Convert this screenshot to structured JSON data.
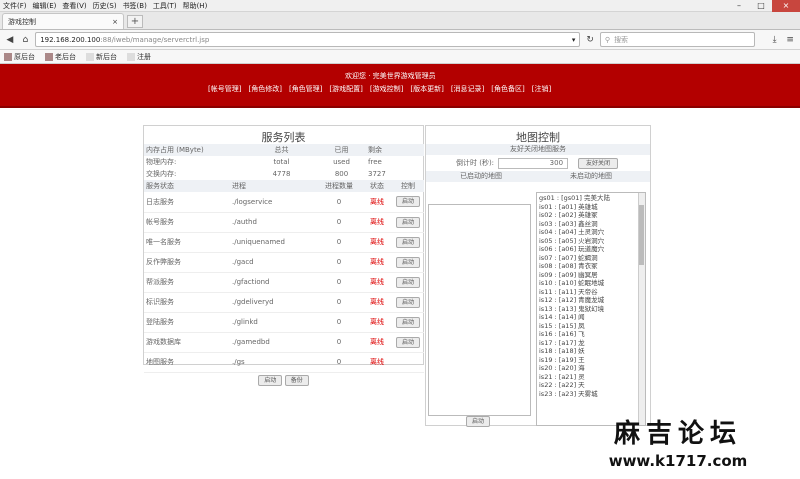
{
  "browser": {
    "menu": [
      "文件(F)",
      "编辑(E)",
      "查看(V)",
      "历史(S)",
      "书签(B)",
      "工具(T)",
      "帮助(H)"
    ],
    "tab_title": "游戏控制",
    "tab_close": "×",
    "new_tab": "+",
    "url_host": "192.168.200.100",
    "url_rest": ":88/iweb/manage/serverctrl.jsp",
    "search_placeholder": "搜索",
    "bookmarks": [
      "原后台",
      "老后台",
      "新后台",
      "注册"
    ]
  },
  "banner": {
    "title": "欢迎您 · 完美世界游戏管理员",
    "menu": [
      "[帐号管理]",
      "[角色修改]",
      "[角色管理]",
      "[游戏配置]",
      "[游戏控制]",
      "[版本更新]",
      "[消息记录]",
      "[角色备区]",
      "[注销]"
    ]
  },
  "service_panel": {
    "title": "服务列表",
    "mem_headers": [
      "内存占用 (MByte)",
      "总共",
      "已用",
      "剩余"
    ],
    "mem_rows": [
      [
        "物理内存:",
        "total",
        "used",
        "free"
      ],
      [
        "交换内存:",
        "4778",
        "800",
        "3727"
      ]
    ],
    "svc_headers": [
      "服务状态",
      "进程",
      "进程数量",
      "状态",
      "控制"
    ],
    "services": [
      {
        "name": "日志服务",
        "proc": "./logservice",
        "count": "0",
        "status": "离线",
        "ctl": "启动"
      },
      {
        "name": "帐号服务",
        "proc": "./authd",
        "count": "0",
        "status": "离线",
        "ctl": "启动"
      },
      {
        "name": "唯一名服务",
        "proc": "./uniquenamed",
        "count": "0",
        "status": "离线",
        "ctl": "启动"
      },
      {
        "name": "反作弊服务",
        "proc": "./gacd",
        "count": "0",
        "status": "离线",
        "ctl": "启动"
      },
      {
        "name": "帮派服务",
        "proc": "./gfactiond",
        "count": "0",
        "status": "离线",
        "ctl": "启动"
      },
      {
        "name": "标识服务",
        "proc": "./gdeliveryd",
        "count": "0",
        "status": "离线",
        "ctl": "启动"
      },
      {
        "name": "登陆服务",
        "proc": "./glinkd",
        "count": "0",
        "status": "离线",
        "ctl": "启动"
      },
      {
        "name": "游戏数据库",
        "proc": "./gamedbd",
        "count": "0",
        "status": "离线",
        "ctl": "启动"
      },
      {
        "name": "地图服务",
        "proc": "./gs",
        "count": "0",
        "status": "离线",
        "ctl": ""
      }
    ],
    "start_btn": "启动",
    "backup_btn": "备份"
  },
  "map_panel": {
    "title": "地图控制",
    "subtitle": "友好关闭地图服务",
    "countdown_label": "倒计时 (秒):",
    "countdown_value": "300",
    "close_btn": "友好关闭",
    "started_label": "已启动的地图",
    "not_started_label": "未启动的地图",
    "maps": [
      "gs01 : [gs01] 完美大陆",
      "is01 : [a01] 英雄城",
      "is02 : [a02] 英雄冢",
      "is03 : [a03] 鑫丝洞",
      "is04 : [a04] 土灵洞穴",
      "is05 : [a05] 火岩洞穴",
      "is06 : [a06] 玩道魔穴",
      "is07 : [a07] 蛇蝎洞",
      "is08 : [a08] 青衣冢",
      "is09 : [a09] 幽冥居",
      "is10 : [a10] 蛇眠地城",
      "is11 : [a11] 天帝谷",
      "is12 : [a12] 青魔龙城",
      "is13 : [a13] 鬼狱幻境",
      "is14 : [a14] 闻",
      "is15 : [a15] 凤",
      "is16 : [a16] 飞",
      "is17 : [a17] 龙",
      "is18 : [a18] 妖",
      "is19 : [a19] 王",
      "is20 : [a20] 海",
      "is21 : [a21] 灵",
      "is22 : [a22] 天",
      "is23 : [a23] 天雾城"
    ],
    "start_btn": "启动"
  },
  "watermark": {
    "text": "麻吉论坛",
    "url": "www.k1717.com"
  }
}
